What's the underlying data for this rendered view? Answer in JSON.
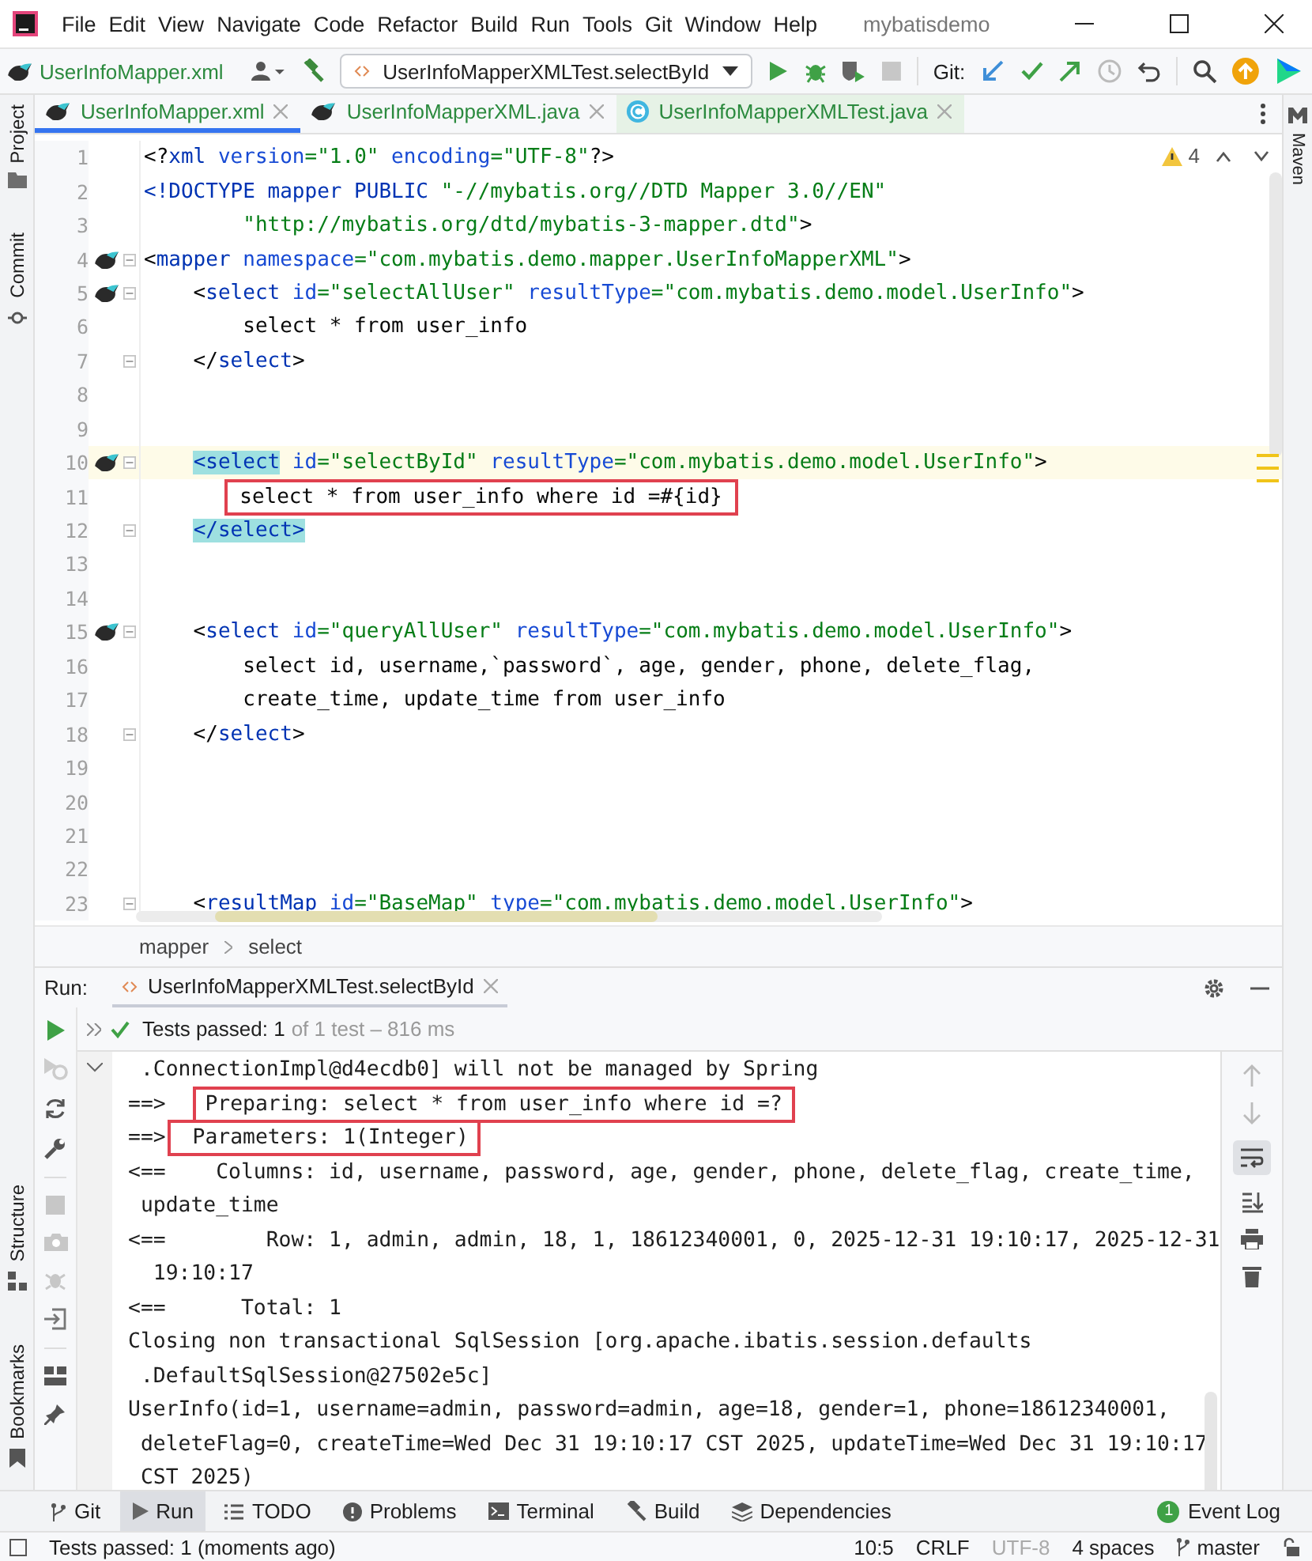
{
  "menu": {
    "items": [
      "File",
      "Edit",
      "View",
      "Navigate",
      "Code",
      "Refactor",
      "Build",
      "Run",
      "Tools",
      "Git",
      "Window",
      "Help"
    ],
    "title": "mybatisdemo"
  },
  "toolbar": {
    "file": "UserInfoMapper.xml",
    "run_config": "UserInfoMapperXMLTest.selectById",
    "git_label": "Git:"
  },
  "left_strip": [
    {
      "label": "Project"
    },
    {
      "label": "Commit"
    },
    {
      "label": "Structure"
    },
    {
      "label": "Bookmarks"
    }
  ],
  "right_strip": [
    {
      "label": "Maven"
    }
  ],
  "tabs": [
    {
      "label": "UserInfoMapper.xml",
      "kind": "xml",
      "selected": true
    },
    {
      "label": "UserInfoMapperXML.java",
      "kind": "xml",
      "selected": false
    },
    {
      "label": "UserInfoMapperXMLTest.java",
      "kind": "class",
      "selected": false
    }
  ],
  "editor": {
    "warnings": "4",
    "lines": [
      {
        "number": "1",
        "bird": false,
        "fold": false,
        "current": false,
        "tokens": [
          {
            "kind": "punct",
            "text": "<?"
          },
          {
            "kind": "tag",
            "text": "xml"
          },
          {
            "kind": "attr",
            "text": " version"
          },
          {
            "kind": "str",
            "text": "=\"1.0\""
          },
          {
            "kind": "attr",
            "text": " encoding"
          },
          {
            "kind": "str",
            "text": "=\"UTF-8\""
          },
          {
            "kind": "punct",
            "text": "?>"
          }
        ]
      },
      {
        "number": "2",
        "bird": false,
        "fold": false,
        "current": false,
        "tokens": [
          {
            "kind": "tag",
            "text": "<!DOCTYPE mapper PUBLIC "
          },
          {
            "kind": "str",
            "text": "\"-//mybatis.org//DTD Mapper 3.0//EN\""
          }
        ]
      },
      {
        "number": "3",
        "bird": false,
        "fold": false,
        "current": false,
        "tokens": [
          {
            "kind": "str",
            "text": "        \"http://mybatis.org/dtd/mybatis-3-mapper.dtd\""
          },
          {
            "kind": "punct",
            "text": ">"
          }
        ]
      },
      {
        "number": "4",
        "bird": true,
        "fold": true,
        "current": false,
        "tokens": [
          {
            "kind": "punct",
            "text": "<"
          },
          {
            "kind": "tag",
            "text": "mapper"
          },
          {
            "kind": "attr",
            "text": " namespace"
          },
          {
            "kind": "str",
            "text": "=\"com.mybatis.demo.mapper.UserInfoMapperXML\""
          },
          {
            "kind": "punct",
            "text": ">"
          }
        ]
      },
      {
        "number": "5",
        "bird": true,
        "fold": true,
        "current": false,
        "tokens": [
          {
            "kind": "punct",
            "text": "    <"
          },
          {
            "kind": "tag",
            "text": "select"
          },
          {
            "kind": "attr",
            "text": " id"
          },
          {
            "kind": "str",
            "text": "=\"selectAllUser\""
          },
          {
            "kind": "attr",
            "text": " resultType"
          },
          {
            "kind": "str",
            "text": "=\"com.mybatis.demo.model.UserInfo\""
          },
          {
            "kind": "punct",
            "text": ">"
          }
        ]
      },
      {
        "number": "6",
        "bird": false,
        "fold": false,
        "current": false,
        "tokens": [
          {
            "kind": "text",
            "text": "        select * from user_info"
          }
        ]
      },
      {
        "number": "7",
        "bird": false,
        "fold": true,
        "current": false,
        "tokens": [
          {
            "kind": "punct",
            "text": "    </"
          },
          {
            "kind": "tag",
            "text": "select"
          },
          {
            "kind": "punct",
            "text": ">"
          }
        ]
      },
      {
        "number": "8",
        "bird": false,
        "fold": false,
        "current": false
      },
      {
        "number": "9",
        "bird": false,
        "fold": false,
        "current": false
      },
      {
        "number": "10",
        "bird": true,
        "fold": true,
        "current": true,
        "tokens": [
          {
            "kind": "match",
            "text": "    <select"
          },
          {
            "kind": "attr",
            "text": " id"
          },
          {
            "kind": "str",
            "text": "=\"selectById\""
          },
          {
            "kind": "attr",
            "text": " resultType"
          },
          {
            "kind": "str",
            "text": "=\"com.mybatis.demo.model.UserInfo\""
          },
          {
            "kind": "punct",
            "text": ">"
          }
        ]
      },
      {
        "number": "11",
        "bird": false,
        "fold": false,
        "current": false,
        "tokens": [
          {
            "kind": "marked",
            "text": "        select * from user_info where id =#{id}"
          }
        ]
      },
      {
        "number": "12",
        "bird": false,
        "fold": true,
        "current": false,
        "tokens": [
          {
            "kind": "match",
            "text": "    </select>"
          }
        ]
      },
      {
        "number": "13",
        "bird": false,
        "fold": false,
        "current": false
      },
      {
        "number": "14",
        "bird": false,
        "fold": false,
        "current": false
      },
      {
        "number": "15",
        "bird": true,
        "fold": true,
        "current": false,
        "tokens": [
          {
            "kind": "punct",
            "text": "    <"
          },
          {
            "kind": "tag",
            "text": "select"
          },
          {
            "kind": "attr",
            "text": " id"
          },
          {
            "kind": "str",
            "text": "=\"queryAllUser\""
          },
          {
            "kind": "attr",
            "text": " resultType"
          },
          {
            "kind": "str",
            "text": "=\"com.mybatis.demo.model.UserInfo\""
          },
          {
            "kind": "punct",
            "text": ">"
          }
        ]
      },
      {
        "number": "16",
        "bird": false,
        "fold": false,
        "current": false,
        "tokens": [
          {
            "kind": "text",
            "text": "        select id, username,`password`, age, gender, phone, delete_flag,"
          }
        ]
      },
      {
        "number": "17",
        "bird": false,
        "fold": false,
        "current": false,
        "tokens": [
          {
            "kind": "text",
            "text": "        create_time, update_time from user_info"
          }
        ]
      },
      {
        "number": "18",
        "bird": false,
        "fold": true,
        "current": false,
        "tokens": [
          {
            "kind": "punct",
            "text": "    </"
          },
          {
            "kind": "tag",
            "text": "select"
          },
          {
            "kind": "punct",
            "text": ">"
          }
        ]
      },
      {
        "number": "19",
        "bird": false,
        "fold": false,
        "current": false
      },
      {
        "number": "20",
        "bird": false,
        "fold": false,
        "current": false
      },
      {
        "number": "21",
        "bird": false,
        "fold": false,
        "current": false
      },
      {
        "number": "22",
        "bird": false,
        "fold": false,
        "current": false
      },
      {
        "number": "23",
        "bird": false,
        "fold": true,
        "current": false,
        "tokens": [
          {
            "kind": "punct",
            "text": "    <"
          },
          {
            "kind": "tag",
            "text": "resultMap"
          },
          {
            "kind": "attr",
            "text": " id"
          },
          {
            "kind": "str",
            "text": "=\"BaseMap\""
          },
          {
            "kind": "attr",
            "text": " type"
          },
          {
            "kind": "str",
            "text": "=\"com.mybatis.demo.model.UserInfo\""
          },
          {
            "kind": "punct",
            "text": ">"
          }
        ]
      }
    ]
  },
  "breadcrumb": [
    "mapper",
    "select"
  ],
  "run": {
    "label": "Run:",
    "tab": "UserInfoMapperXMLTest.selectById",
    "status": "Tests passed: 1",
    "detail": "of 1 test – 816 ms",
    "console": [
      [
        {
          "kind": "plain",
          "text": " .ConnectionImpl@d4ecdb0] will not be managed by Spring"
        }
      ],
      [
        {
          "kind": "plain",
          "text": "==>  "
        },
        {
          "kind": "marked",
          "text": "Preparing: select * from user_info where id =?"
        }
      ],
      [
        {
          "kind": "plain",
          "text": "==>"
        },
        {
          "kind": "marked",
          "text": " Parameters: 1(Integer)"
        }
      ],
      [
        {
          "kind": "plain",
          "text": "<==    Columns: id, username, password, age, gender, phone, delete_flag, create_time,"
        }
      ],
      [
        {
          "kind": "plain",
          "text": " update_time"
        }
      ],
      [
        {
          "kind": "plain",
          "text": "<==        Row: 1, admin, admin, 18, 1, 18612340001, 0, 2025-12-31 19:10:17, 2025-12-31"
        }
      ],
      [
        {
          "kind": "plain",
          "text": "  19:10:17"
        }
      ],
      [
        {
          "kind": "plain",
          "text": "<==      Total: 1"
        }
      ],
      [
        {
          "kind": "plain",
          "text": "Closing non transactional SqlSession [org.apache.ibatis.session.defaults"
        }
      ],
      [
        {
          "kind": "plain",
          "text": " .DefaultSqlSession@27502e5c]"
        }
      ],
      [
        {
          "kind": "plain",
          "text": "UserInfo(id=1, username=admin, password=admin, age=18, gender=1, phone=18612340001,"
        }
      ],
      [
        {
          "kind": "plain",
          "text": " deleteFlag=0, createTime=Wed Dec 31 19:10:17 CST 2025, updateTime=Wed Dec 31 19:10:17"
        }
      ],
      [
        {
          "kind": "plain",
          "text": " CST 2025)"
        }
      ]
    ]
  },
  "tool_windows": [
    {
      "label": "Git",
      "kind": "git",
      "selected": false
    },
    {
      "label": "Run",
      "kind": "run",
      "selected": true
    },
    {
      "label": "TODO",
      "kind": "todo",
      "selected": false
    },
    {
      "label": "Problems",
      "kind": "problems",
      "selected": false
    },
    {
      "label": "Terminal",
      "kind": "terminal",
      "selected": false
    },
    {
      "label": "Build",
      "kind": "build",
      "selected": false
    },
    {
      "label": "Dependencies",
      "kind": "deps",
      "selected": false
    }
  ],
  "event_log": {
    "label": "Event Log",
    "count": "1"
  },
  "status_bar": {
    "message": "Tests passed: 1 (moments ago)",
    "position": "10:5",
    "line_ending": "CRLF",
    "encoding": "UTF-8",
    "encoding_disabled": true,
    "indent": "4 spaces",
    "branch": "master"
  }
}
